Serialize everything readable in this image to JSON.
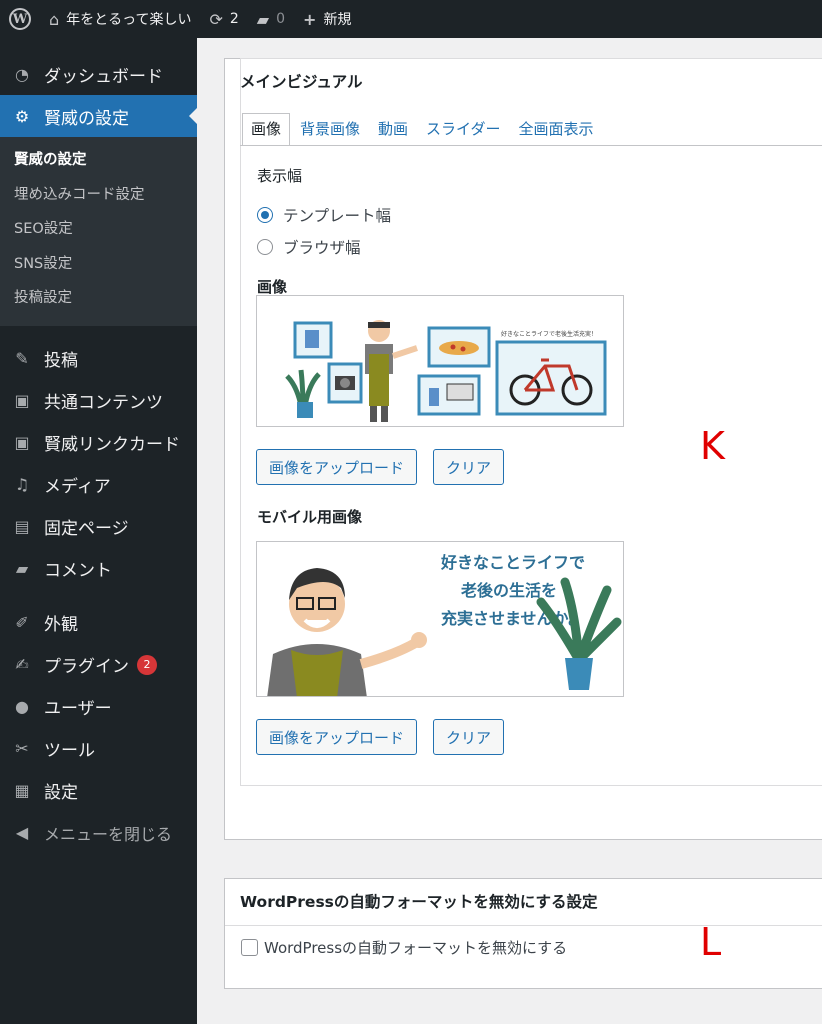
{
  "adminbar": {
    "site_name": "年をとるって楽しい",
    "updates_count": "2",
    "comments_count": "0",
    "new_label": "新規"
  },
  "sidebar": {
    "dashboard": "ダッシュボード",
    "current": "賢威の設定",
    "submenu": [
      "賢威の設定",
      "埋め込みコード設定",
      "SEO設定",
      "SNS設定",
      "投稿設定"
    ],
    "posts": "投稿",
    "common_contents": "共通コンテンツ",
    "link_card": "賢威リンクカード",
    "media": "メディア",
    "pages": "固定ページ",
    "comments": "コメント",
    "appearance": "外観",
    "plugins": "プラグイン",
    "plugins_badge": "2",
    "users": "ユーザー",
    "tools": "ツール",
    "settings": "設定",
    "collapse": "メニューを閉じる"
  },
  "main_visual": {
    "title": "メインビジュアル",
    "tabs": [
      "画像",
      "背景画像",
      "動画",
      "スライダー",
      "全画面表示"
    ],
    "display_width_label": "表示幅",
    "radio_template": "テンプレート幅",
    "radio_browser": "ブラウザ幅",
    "image_label": "画像",
    "image_banner_text": "好きなことライフで老後生活充実！",
    "upload_button": "画像をアップロード",
    "clear_button": "クリア",
    "mobile_image_label": "モバイル用画像",
    "mobile_text_1": "好きなことライフで",
    "mobile_text_2": "老後の生活を",
    "mobile_text_3": "充実させませんか。",
    "mobile_upload_button": "画像をアップロード",
    "mobile_clear_button": "クリア"
  },
  "autoformat": {
    "title": "WordPressの自動フォーマットを無効にする設定",
    "checkbox_label": "WordPressの自動フォーマットを無効にする"
  },
  "markers": {
    "k": "K",
    "l": "L"
  },
  "colors": {
    "accent": "#2271b1",
    "sidebar_bg": "#1d2327",
    "marker": "#e00000"
  }
}
